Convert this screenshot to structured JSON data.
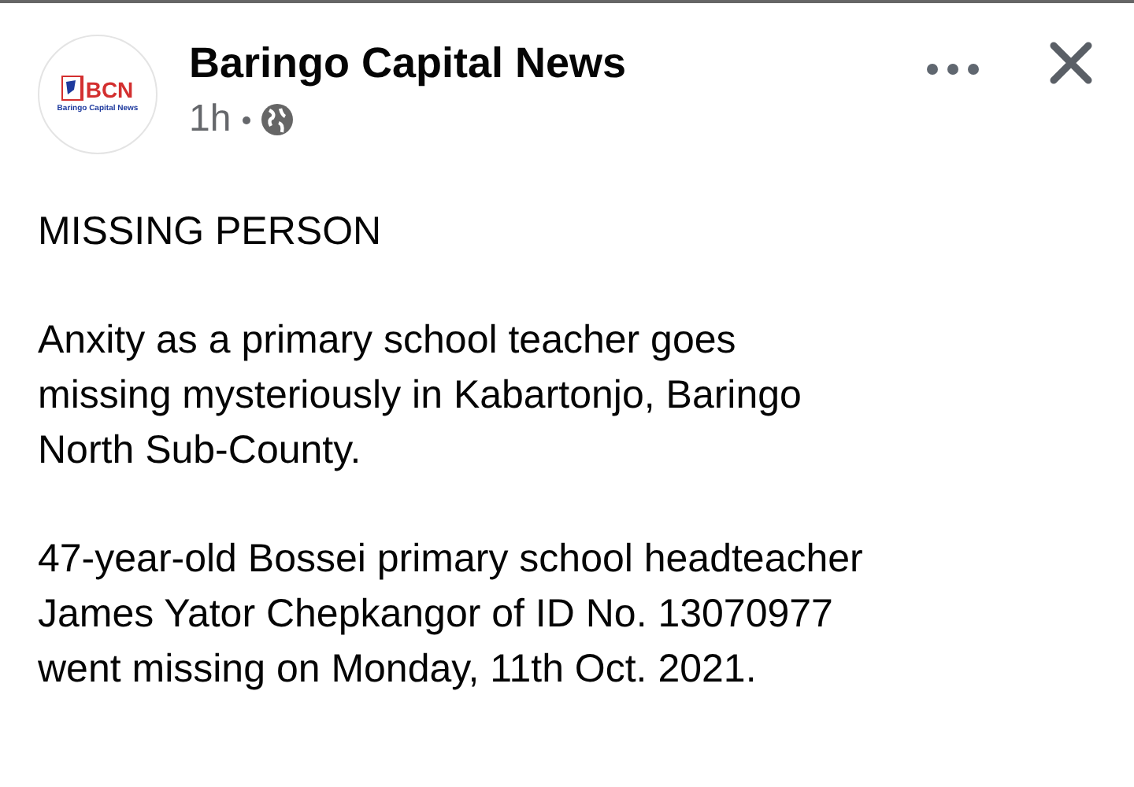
{
  "post": {
    "page_name": "Baringo Capital News",
    "time": "1h",
    "logo": {
      "initials": "BCN",
      "subtitle": "Baringo Capital News"
    },
    "paragraphs": [
      [
        "MISSING PERSON"
      ],
      [
        "Anxity as a primary school teacher goes",
        "missing mysteriously in Kabartonjo, Baringo",
        "North Sub-County."
      ],
      [
        "47-year-old Bossei primary school headteacher",
        "James Yator Chepkangor of ID No. 13070977",
        "went missing on Monday, 11th Oct. 2021."
      ]
    ]
  }
}
